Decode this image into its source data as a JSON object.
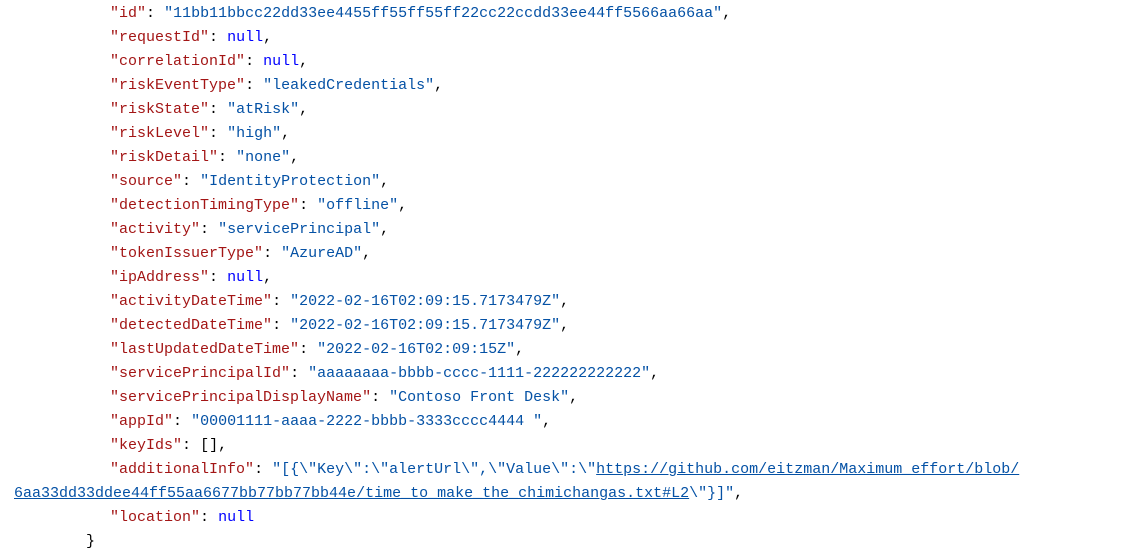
{
  "fields": {
    "id": {
      "key": "id",
      "value": "11bb11bbcc22dd33ee4455ff55ff55ff22cc22ccdd33ee44ff5566aa66aa"
    },
    "requestId": {
      "key": "requestId",
      "value": "null"
    },
    "correlationId": {
      "key": "correlationId",
      "value": "null"
    },
    "riskEventType": {
      "key": "riskEventType",
      "value": "leakedCredentials"
    },
    "riskState": {
      "key": "riskState",
      "value": "atRisk"
    },
    "riskLevel": {
      "key": "riskLevel",
      "value": "high"
    },
    "riskDetail": {
      "key": "riskDetail",
      "value": "none"
    },
    "source": {
      "key": "source",
      "value": "IdentityProtection"
    },
    "detectionTimingType": {
      "key": "detectionTimingType",
      "value": "offline"
    },
    "activity": {
      "key": "activity",
      "value": "servicePrincipal"
    },
    "tokenIssuerType": {
      "key": "tokenIssuerType",
      "value": "AzureAD"
    },
    "ipAddress": {
      "key": "ipAddress",
      "value": "null"
    },
    "activityDateTime": {
      "key": "activityDateTime",
      "value": "2022-02-16T02:09:15.7173479Z"
    },
    "detectedDateTime": {
      "key": "detectedDateTime",
      "value": "2022-02-16T02:09:15.7173479Z"
    },
    "lastUpdatedDateTime": {
      "key": "lastUpdatedDateTime",
      "value": "2022-02-16T02:09:15Z"
    },
    "servicePrincipalId": {
      "key": "servicePrincipalId",
      "value": "aaaaaaaa-bbbb-cccc-1111-222222222222"
    },
    "servicePrincipalDisplayName": {
      "key": "servicePrincipalDisplayName",
      "value": "Contoso Front Desk"
    },
    "appId": {
      "key": "appId",
      "value": "00001111-aaaa-2222-bbbb-3333cccc4444 "
    },
    "keyIds": {
      "key": "keyIds",
      "value": "[]"
    },
    "additionalInfo": {
      "key": "additionalInfo",
      "prefix": "[{\\\"Key\\\":\\\"alertUrl\\\",\\\"Value\\\":\\\"",
      "url1": "https://github.com/eitzman/Maximum_effort/blob/",
      "url2a": "6aa33dd33ddee44ff55aa6677bb77bb77bb44e",
      "url2b": "/time_to_make_the_chimichangas.txt#L2",
      "suffix": "\\\"}]"
    },
    "location": {
      "key": "location",
      "value": "null"
    }
  },
  "closingBrace": "}"
}
